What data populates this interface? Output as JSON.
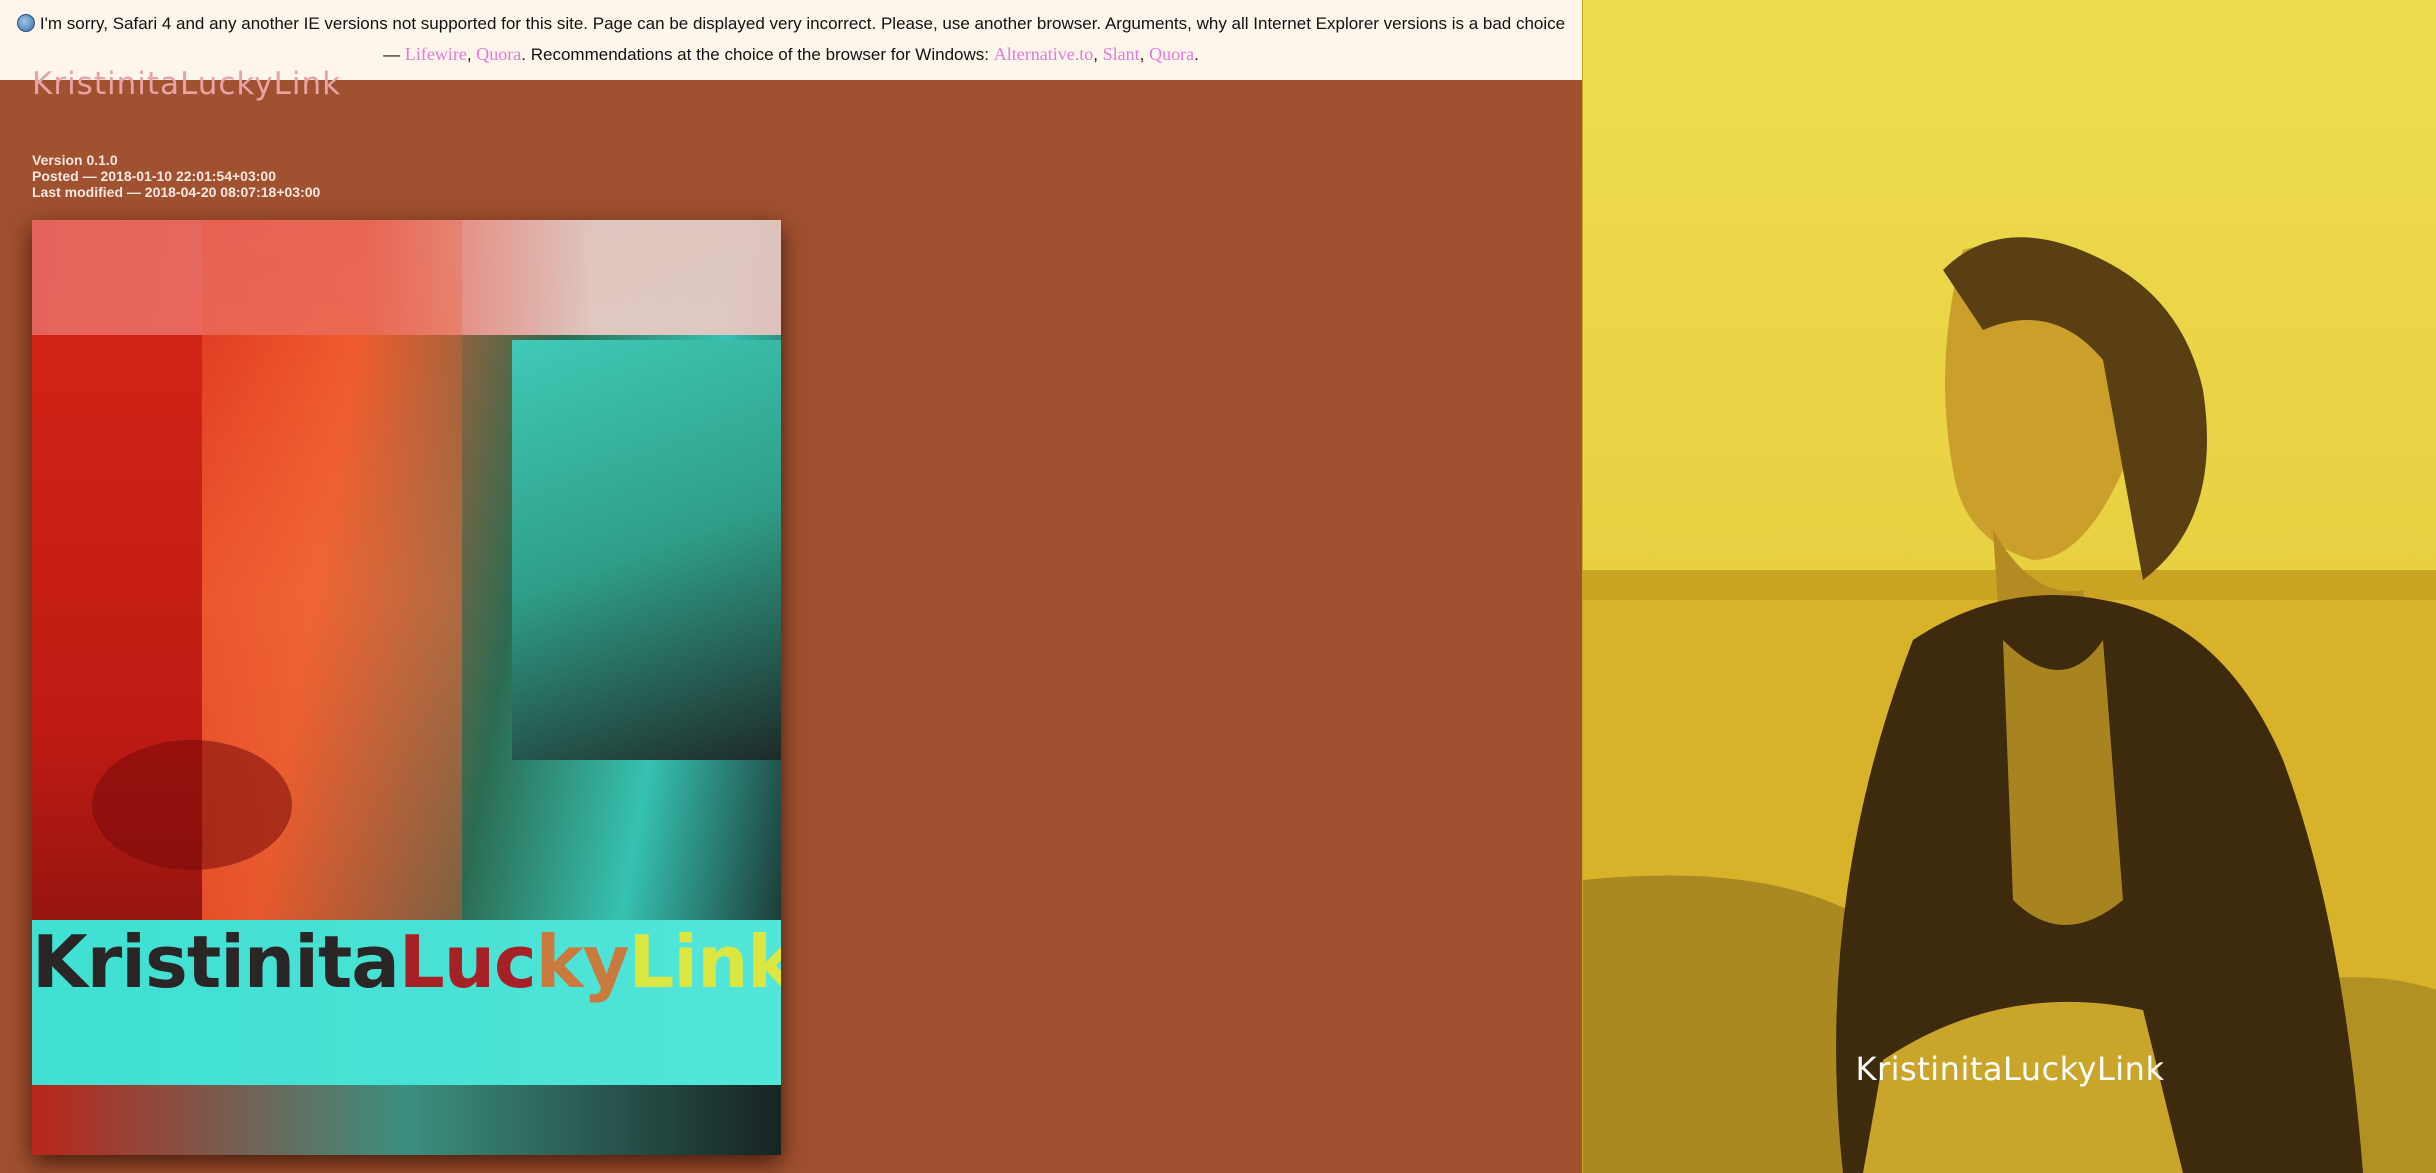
{
  "banner": {
    "text_main": "I'm sorry, Safari 4 and any another IE versions not supported for this site. Page can be displayed very incorrect. Please, use another browser. Arguments, why all Internet Explorer versions is a bad choice — ",
    "link_lifewire": "Lifewire",
    "sep1": ", ",
    "link_quora_1": "Quora",
    "text_recommend": ". Recommendations at the choice of the browser for Windows: ",
    "link_alternativeto": "Alternative.to",
    "sep2": ", ",
    "link_slant": "Slant",
    "sep3": ", ",
    "link_quora_2": "Quora",
    "end": "."
  },
  "site": {
    "title": "KristinitaLuckyLink"
  },
  "meta": {
    "version": "Version 0.1.0",
    "posted": "Posted — 2018-01-10 22:01:54+03:00",
    "modified": "Last modified — 2018-04-20 08:07:18+03:00"
  },
  "cover": {
    "logo_part1": "Kristinita",
    "logo_part2": "Luc",
    "logo_part3": "ky",
    "logo_part4": "Link"
  },
  "panel": {
    "caption": "KristinitaLuckyLink"
  },
  "colors": {
    "page_background": "#a0512f",
    "banner_background": "#fff6eb",
    "link": "#e27ad8",
    "title": "#e8a3a6",
    "panel_yellow": "#eedc50"
  }
}
